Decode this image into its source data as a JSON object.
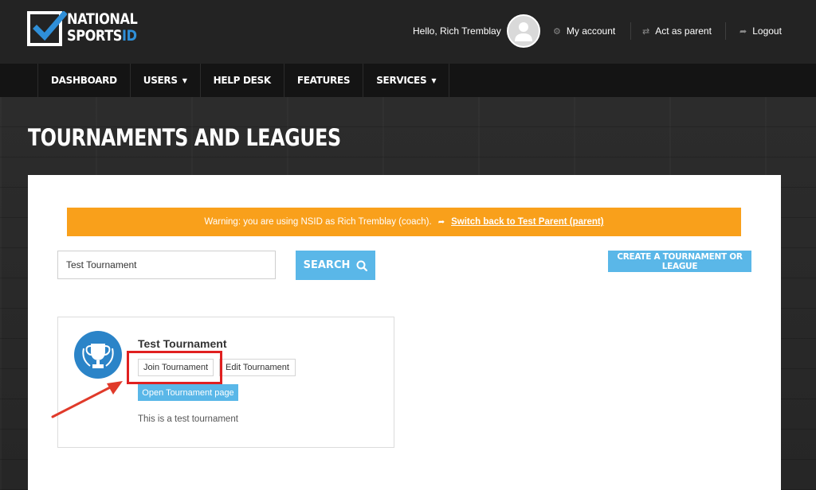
{
  "brand": {
    "logo_line1": "NATIONAL",
    "logo_line2_a": "SPORTS",
    "logo_line2_b": "ID",
    "accent_color": "#2f8fd8"
  },
  "header": {
    "greeting": "Hello, Rich Tremblay",
    "links": [
      {
        "label": "My account",
        "icon": "gear-icon"
      },
      {
        "label": "Act as parent",
        "icon": "swap-icon"
      },
      {
        "label": "Logout",
        "icon": "logout-icon"
      }
    ]
  },
  "nav": {
    "items": [
      {
        "label": "DASHBOARD",
        "dropdown": false
      },
      {
        "label": "USERS",
        "dropdown": true
      },
      {
        "label": "HELP DESK",
        "dropdown": false
      },
      {
        "label": "FEATURES",
        "dropdown": false
      },
      {
        "label": "SERVICES",
        "dropdown": true
      }
    ]
  },
  "page": {
    "title": "TOURNAMENTS AND LEAGUES"
  },
  "warning": {
    "text": "Warning: you are using NSID as Rich Tremblay (coach).",
    "link": "Switch back to Test Parent (parent)",
    "color": "#f9a01b"
  },
  "search": {
    "value": "Test Tournament",
    "button_label": "SEARCH",
    "create_label": "CREATE A TOURNAMENT OR LEAGUE",
    "button_color": "#5ab7e8"
  },
  "tournament": {
    "name": "Test Tournament",
    "join_label": "Join Tournament",
    "edit_label": "Edit Tournament",
    "open_label": "Open Tournament page",
    "description": "This is a test tournament",
    "icon": "trophy-icon",
    "highlight_color": "#e02020"
  }
}
